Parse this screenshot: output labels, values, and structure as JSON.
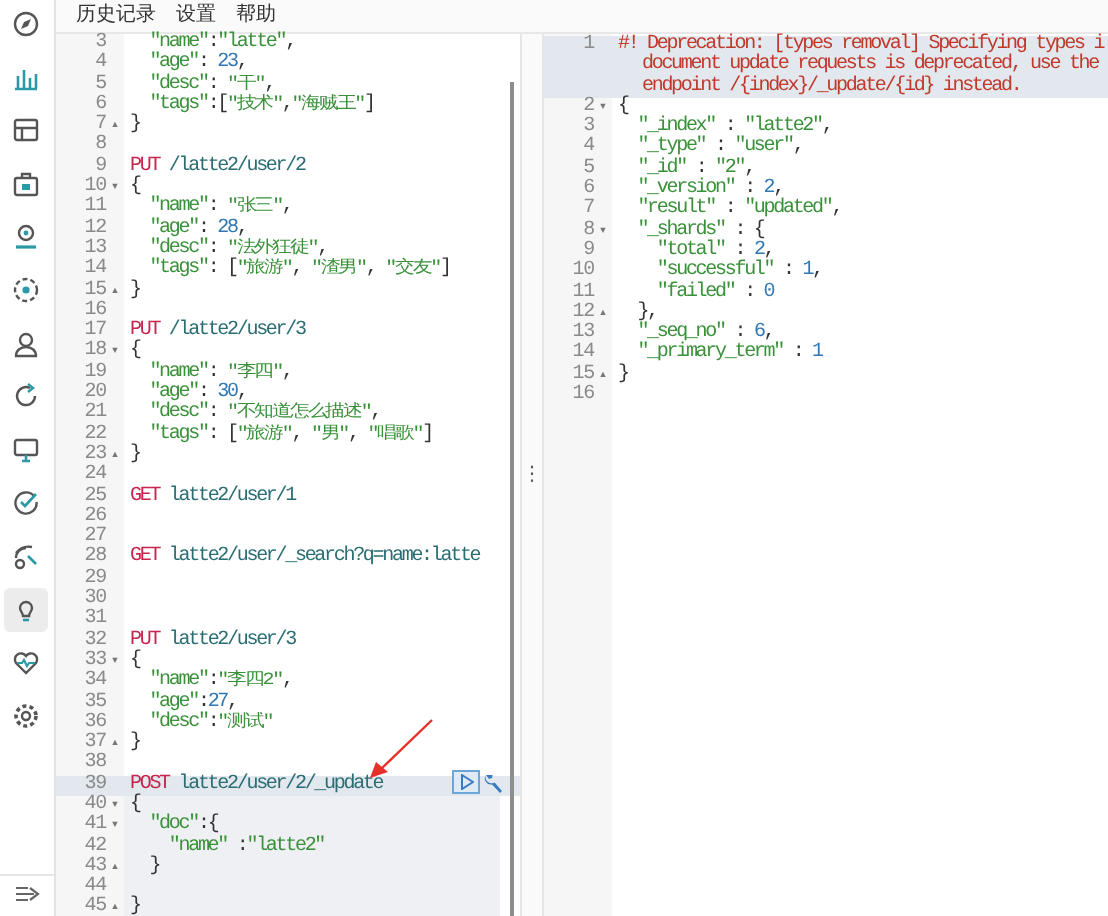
{
  "sidebar": {
    "items": [
      {
        "selected": false
      },
      {
        "selected": false
      },
      {
        "selected": false
      },
      {
        "selected": false
      },
      {
        "selected": false
      },
      {
        "selected": false
      },
      {
        "selected": false
      },
      {
        "selected": false
      },
      {
        "selected": false
      },
      {
        "selected": false
      },
      {
        "selected": false
      },
      {
        "selected": true
      },
      {
        "selected": false
      },
      {
        "selected": false
      }
    ]
  },
  "menu": [
    "历史记录",
    "设置",
    "帮助"
  ],
  "editor": {
    "lines": [
      {
        "number": "3",
        "current": false,
        "selected": false,
        "text": "  \"name\":\"latte\","
      },
      {
        "number": "4",
        "current": false,
        "selected": false,
        "text": "  \"age\": 23,"
      },
      {
        "number": "5",
        "current": false,
        "selected": false,
        "text": "  \"desc\": \"干\","
      },
      {
        "number": "6",
        "current": false,
        "selected": false,
        "text": "  \"tags\":[\"技术\",\"海贼王\"]"
      },
      {
        "number": "7",
        "current": false,
        "selected": false,
        "fold": "▴",
        "text": "}"
      },
      {
        "number": "8",
        "current": false,
        "selected": false
      },
      {
        "number": "9",
        "current": false,
        "selected": false,
        "text": "PUT /latte2/user/2"
      },
      {
        "number": "10",
        "current": false,
        "selected": false,
        "fold": "▾",
        "text": "{"
      },
      {
        "number": "11",
        "current": false,
        "selected": false,
        "text": "  \"name\": \"张三\","
      },
      {
        "number": "12",
        "current": false,
        "selected": false,
        "text": "  \"age\": 28,"
      },
      {
        "number": "13",
        "current": false,
        "selected": false,
        "text": "  \"desc\": \"法外狂徒\","
      },
      {
        "number": "14",
        "current": false,
        "selected": false,
        "text": "  \"tags\": [\"旅游\", \"渣男\", \"交友\"]"
      },
      {
        "number": "15",
        "current": false,
        "selected": false,
        "fold": "▴",
        "text": "}"
      },
      {
        "number": "16",
        "current": false,
        "selected": false
      },
      {
        "number": "17",
        "current": false,
        "selected": false,
        "text": "PUT /latte2/user/3"
      },
      {
        "number": "18",
        "current": false,
        "selected": false,
        "fold": "▾",
        "text": "{"
      },
      {
        "number": "19",
        "current": false,
        "selected": false,
        "text": "  \"name\": \"李四\","
      },
      {
        "number": "20",
        "current": false,
        "selected": false,
        "text": "  \"age\": 30,"
      },
      {
        "number": "21",
        "current": false,
        "selected": false,
        "text": "  \"desc\": \"不知道怎么描述\","
      },
      {
        "number": "22",
        "current": false,
        "selected": false,
        "text": "  \"tags\": [\"旅游\", \"男\", \"唱歌\"]"
      },
      {
        "number": "23",
        "current": false,
        "selected": false,
        "fold": "▴",
        "text": "}"
      },
      {
        "number": "24",
        "current": false,
        "selected": false
      },
      {
        "number": "25",
        "current": false,
        "selected": false,
        "text": "GET latte2/user/1"
      },
      {
        "number": "26",
        "current": false,
        "selected": false
      },
      {
        "number": "27",
        "current": false,
        "selected": false
      },
      {
        "number": "28",
        "current": false,
        "selected": false,
        "text": "GET latte2/user/_search?q=name:latte"
      },
      {
        "number": "29",
        "current": false,
        "selected": false
      },
      {
        "number": "30",
        "current": false,
        "selected": false
      },
      {
        "number": "31",
        "current": false,
        "selected": false
      },
      {
        "number": "32",
        "current": false,
        "selected": false,
        "text": "PUT latte2/user/3"
      },
      {
        "number": "33",
        "current": false,
        "selected": false,
        "fold": "▾",
        "text": "{"
      },
      {
        "number": "34",
        "current": false,
        "selected": false,
        "text": "  \"name\":\"李四2\","
      },
      {
        "number": "35",
        "current": false,
        "selected": false,
        "text": "  \"age\":27,"
      },
      {
        "number": "36",
        "current": false,
        "selected": false,
        "text": "  \"desc\":\"测试\""
      },
      {
        "number": "37",
        "current": false,
        "selected": false,
        "fold": "▴",
        "text": "}"
      },
      {
        "number": "38",
        "current": false,
        "selected": false
      },
      {
        "number": "39",
        "current": true,
        "selected": true,
        "text": "POST latte2/user/2/_update"
      },
      {
        "number": "40",
        "current": false,
        "selected": true,
        "fold": "▾",
        "text": "{"
      },
      {
        "number": "41",
        "current": false,
        "selected": true,
        "fold": "▾",
        "text": "  \"doc\":{"
      },
      {
        "number": "42",
        "current": false,
        "selected": true,
        "text": "    \"name\" :\"latte2\""
      },
      {
        "number": "43",
        "current": false,
        "selected": true,
        "fold": "▴",
        "text": "  }"
      },
      {
        "number": "44",
        "current": false,
        "selected": true
      },
      {
        "number": "45",
        "current": false,
        "selected": true,
        "fold": "▴",
        "text": "}"
      }
    ]
  },
  "divider_handle": "⋮",
  "response": {
    "lines": [
      {
        "number": "1",
        "current": true,
        "text": [
          "#! Deprecation: [types removal] Specifying types i",
          "document update requests is deprecated, use the",
          "endpoint /{index}/_update/{id} instead."
        ]
      },
      {
        "number": "2",
        "current": false,
        "fold": "▾",
        "text": [
          "{"
        ]
      },
      {
        "number": "3",
        "current": false,
        "text": [
          "  \"_index\" : \"latte2\","
        ]
      },
      {
        "number": "4",
        "current": false,
        "text": [
          "  \"_type\" : \"user\","
        ]
      },
      {
        "number": "5",
        "current": false,
        "text": [
          "  \"_id\" : \"2\","
        ]
      },
      {
        "number": "6",
        "current": false,
        "text": [
          "  \"_version\" : 2,"
        ]
      },
      {
        "number": "7",
        "current": false,
        "text": [
          "  \"result\" : \"updated\","
        ]
      },
      {
        "number": "8",
        "current": false,
        "fold": "▾",
        "text": [
          "  \"_shards\" : {"
        ]
      },
      {
        "number": "9",
        "current": false,
        "text": [
          "    \"total\" : 2,"
        ]
      },
      {
        "number": "10",
        "current": false,
        "text": [
          "    \"successful\" : 1,"
        ]
      },
      {
        "number": "11",
        "current": false,
        "text": [
          "    \"failed\" : 0"
        ]
      },
      {
        "number": "12",
        "current": false,
        "fold": "▴",
        "text": [
          "  },"
        ]
      },
      {
        "number": "13",
        "current": false,
        "text": [
          "  \"_seq_no\" : 6,"
        ]
      },
      {
        "number": "14",
        "current": false,
        "text": [
          "  \"_primary_term\" : 1"
        ]
      },
      {
        "number": "15",
        "current": false,
        "fold": "▴",
        "text": [
          "}"
        ]
      },
      {
        "number": "16",
        "current": false
      }
    ]
  }
}
